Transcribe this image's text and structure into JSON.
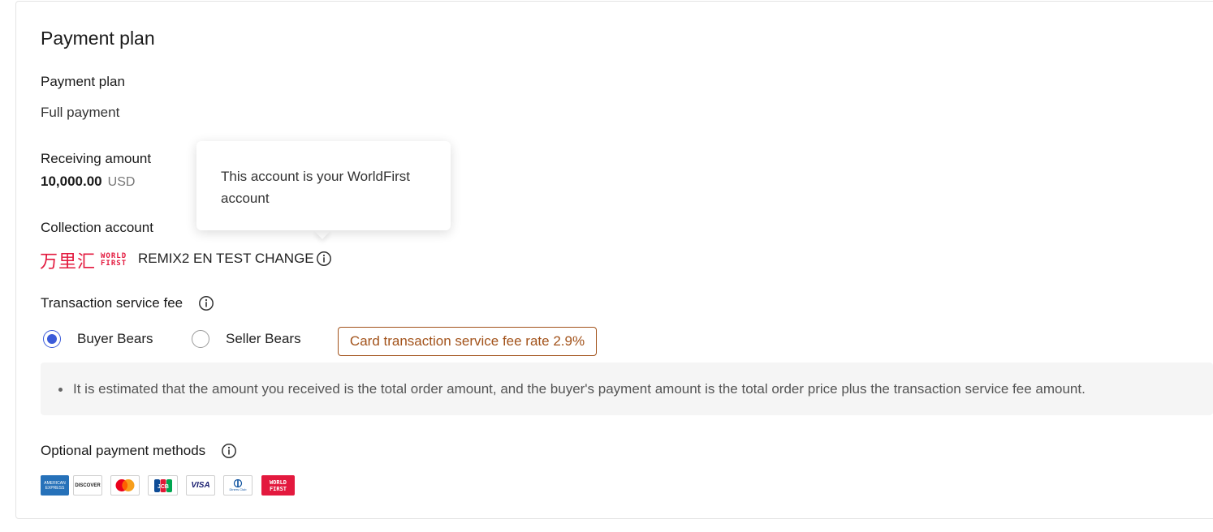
{
  "section_title": "Payment plan",
  "payment_plan": {
    "label": "Payment plan",
    "value": "Full payment"
  },
  "receiving_amount": {
    "label": "Receiving amount",
    "amount": "10,000.00",
    "currency": "USD"
  },
  "collection_account": {
    "label": "Collection account",
    "logo_cn": "万里汇",
    "logo_en_line1": "WORLD",
    "logo_en_line2": "FIRST",
    "account_name": "REMIX2 EN TEST CHANGE",
    "info_icon": "info-icon"
  },
  "tooltip": {
    "text": "This account is your WorldFirst account"
  },
  "transaction_fee": {
    "label": "Transaction service fee",
    "options": [
      {
        "label": "Buyer Bears",
        "selected": true
      },
      {
        "label": "Seller Bears",
        "selected": false
      }
    ],
    "rate_badge": "Card transaction service fee rate 2.9%",
    "note": "It is estimated that the amount you received is the total order amount, and the buyer's payment amount is the total order price plus the transaction service fee amount."
  },
  "payment_methods": {
    "label": "Optional payment methods",
    "items": [
      {
        "name": "amex-icon",
        "label_line1": "AMERICAN",
        "label_line2": "EXPRESS"
      },
      {
        "name": "discover-icon",
        "label": "DISCOVER"
      },
      {
        "name": "mastercard-icon"
      },
      {
        "name": "jcb-icon",
        "label": "JCB"
      },
      {
        "name": "visa-icon",
        "label": "VISA"
      },
      {
        "name": "diners-club-icon",
        "label": "Diners Club"
      },
      {
        "name": "worldfirst-icon",
        "label_line1": "WORLD",
        "label_line2": "FIRST"
      }
    ]
  },
  "colors": {
    "accent": "#3b5bd9",
    "brand_red": "#e3193e",
    "warning": "#a2521a"
  }
}
